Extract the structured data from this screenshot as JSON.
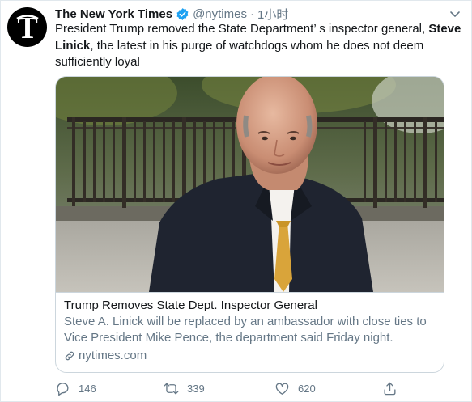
{
  "account": {
    "name": "The New York Times",
    "handle": "@nytimes",
    "separator": "·",
    "time": "1小时"
  },
  "tweet": {
    "text_part1": "President Trump removed the State Department’ s inspector general, ",
    "text_bold": "Steve Linick",
    "text_part2": ", the latest in his purge of watchdogs whom he does not deem sufficiently loyal"
  },
  "card": {
    "title": "Trump Removes State Dept. Inspector General",
    "description": "Steve A. Linick will be replaced by an ambassador with close ties to Vice President Mike Pence, the department said Friday night.",
    "domain": "nytimes.com"
  },
  "actions": {
    "reply_count": "146",
    "retweet_count": "339",
    "like_count": "620"
  },
  "icons": {
    "avatar": "nyt-logo-icon",
    "verified": "verified-badge-icon",
    "more": "chevron-down-icon",
    "link": "link-icon",
    "reply": "reply-icon",
    "retweet": "retweet-icon",
    "like": "heart-icon",
    "share": "share-icon"
  },
  "colors": {
    "verified": "#1da1f2",
    "secondary_text": "#657786",
    "border": "#ccd6dd"
  }
}
